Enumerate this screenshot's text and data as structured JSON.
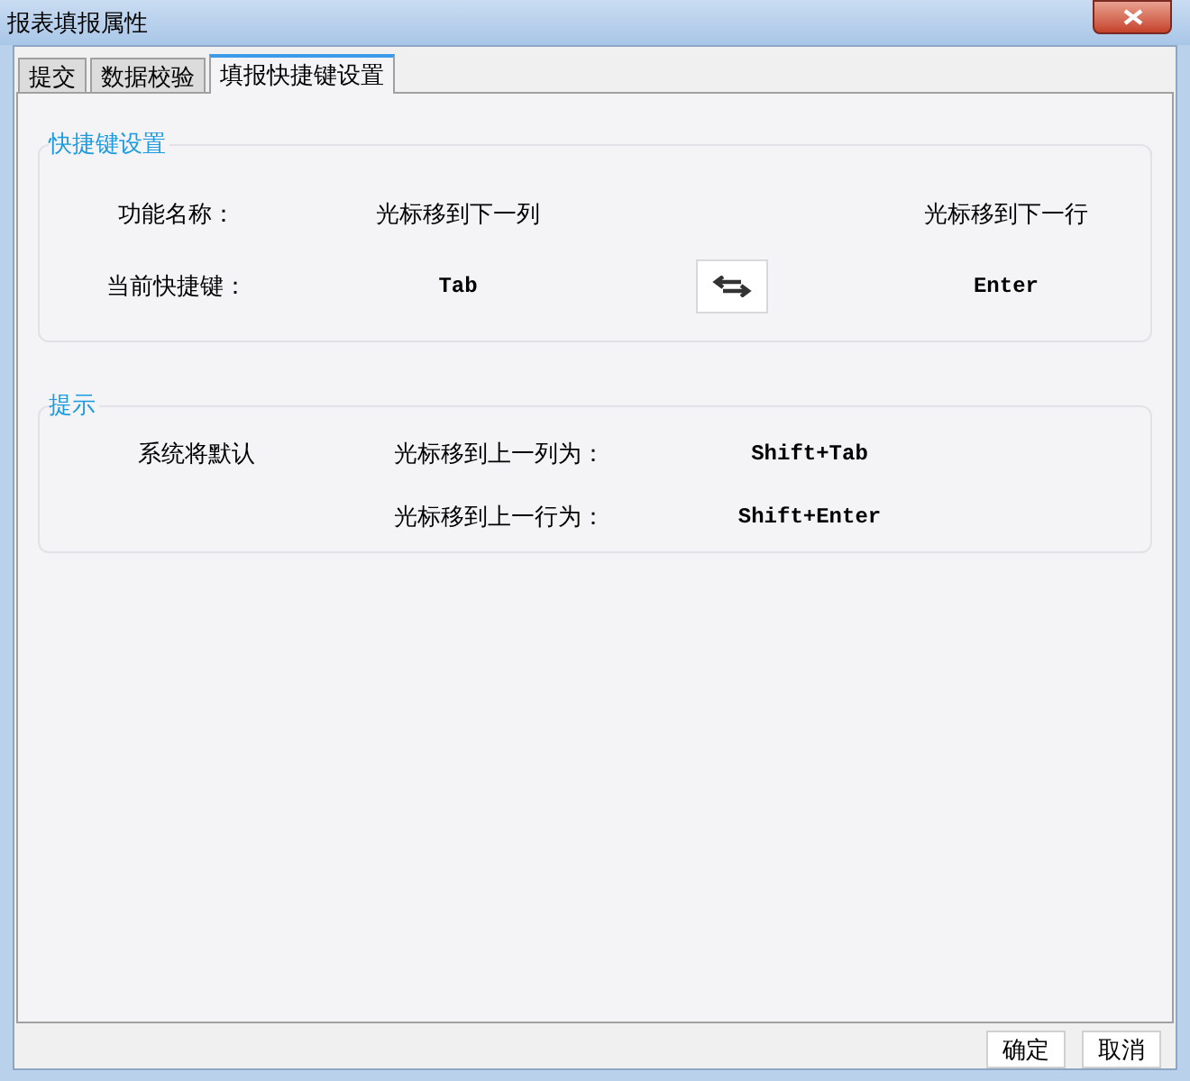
{
  "window": {
    "title": "报表填报属性"
  },
  "tabs": [
    {
      "label": "提交",
      "selected": false
    },
    {
      "label": "数据校验",
      "selected": false
    },
    {
      "label": "填报快捷键设置",
      "selected": true
    }
  ],
  "shortcut_group": {
    "title": "快捷键设置",
    "rows": [
      {
        "label": "功能名称：",
        "values": [
          "光标移到下一列",
          "光标移到下一行"
        ]
      },
      {
        "label": "当前快捷键：",
        "values": [
          "Tab",
          "Enter"
        ]
      }
    ]
  },
  "hint_group": {
    "title": "提示",
    "intro": "系统将默认",
    "rows": [
      {
        "label": "光标移到上一列为：",
        "key": "Shift+Tab"
      },
      {
        "label": "光标移到上一行为：",
        "key": "Shift+Enter"
      }
    ]
  },
  "buttons": [
    "确定",
    "取消"
  ]
}
